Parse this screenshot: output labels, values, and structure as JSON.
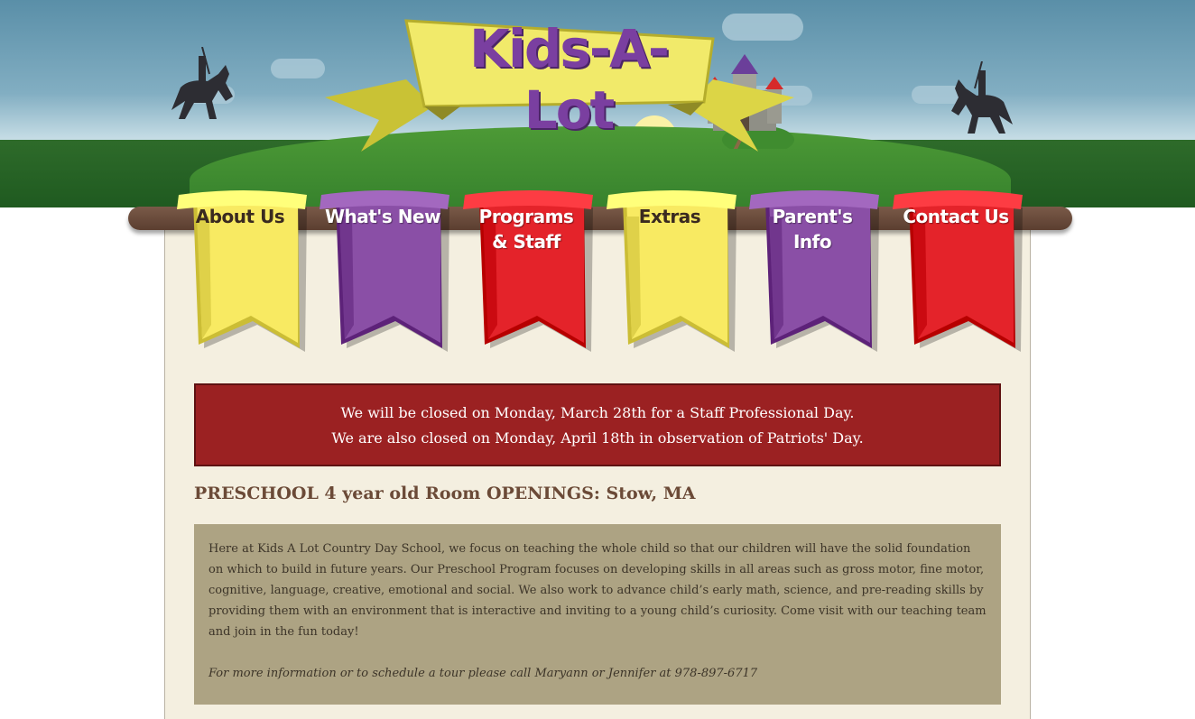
{
  "logo": {
    "text": "Kids-A-Lot"
  },
  "nav": {
    "items": [
      {
        "label": "About Us",
        "color": "#f8ea62"
      },
      {
        "label": "What's New",
        "color": "#8a4fa6"
      },
      {
        "label": "Programs\n& Staff",
        "color": "#e4232a"
      },
      {
        "label": "Extras",
        "color": "#f8ea62"
      },
      {
        "label": "Parent's\nInfo",
        "color": "#8a4fa6"
      },
      {
        "label": "Contact Us",
        "color": "#e4232a"
      }
    ]
  },
  "alert": {
    "line1": "We will be closed on Monday, March 28th for a Staff Professional Day.",
    "line2": "We are also closed on Monday, April 18th in observation of Patriots' Day."
  },
  "main": {
    "heading": "PRESCHOOL 4 year old Room OPENINGS: Stow, MA",
    "paragraph": "Here at Kids A Lot Country Day School, we focus on teaching the whole child so that our children will have the solid foundation on which to build in future years. Our Preschool Program focuses on developing skills in all areas such as gross motor, fine motor, cognitive, language, creative, emotional and social. We also work to advance child’s early math, science, and pre-reading skills by providing them with an environment that is interactive and inviting to a young child’s curiosity. Come visit with our teaching team and join in the fun today!",
    "cta": "For more information or to schedule a tour please call Maryann or Jennifer at 978-897-6717"
  },
  "colors": {
    "yellow": "#f8ea62",
    "purple": "#8a4fa6",
    "red": "#e4232a",
    "alert_bg": "#9b2122",
    "heading": "#6b4a37",
    "infobox_bg": "#ada383",
    "page_bg": "#f4efe0"
  }
}
